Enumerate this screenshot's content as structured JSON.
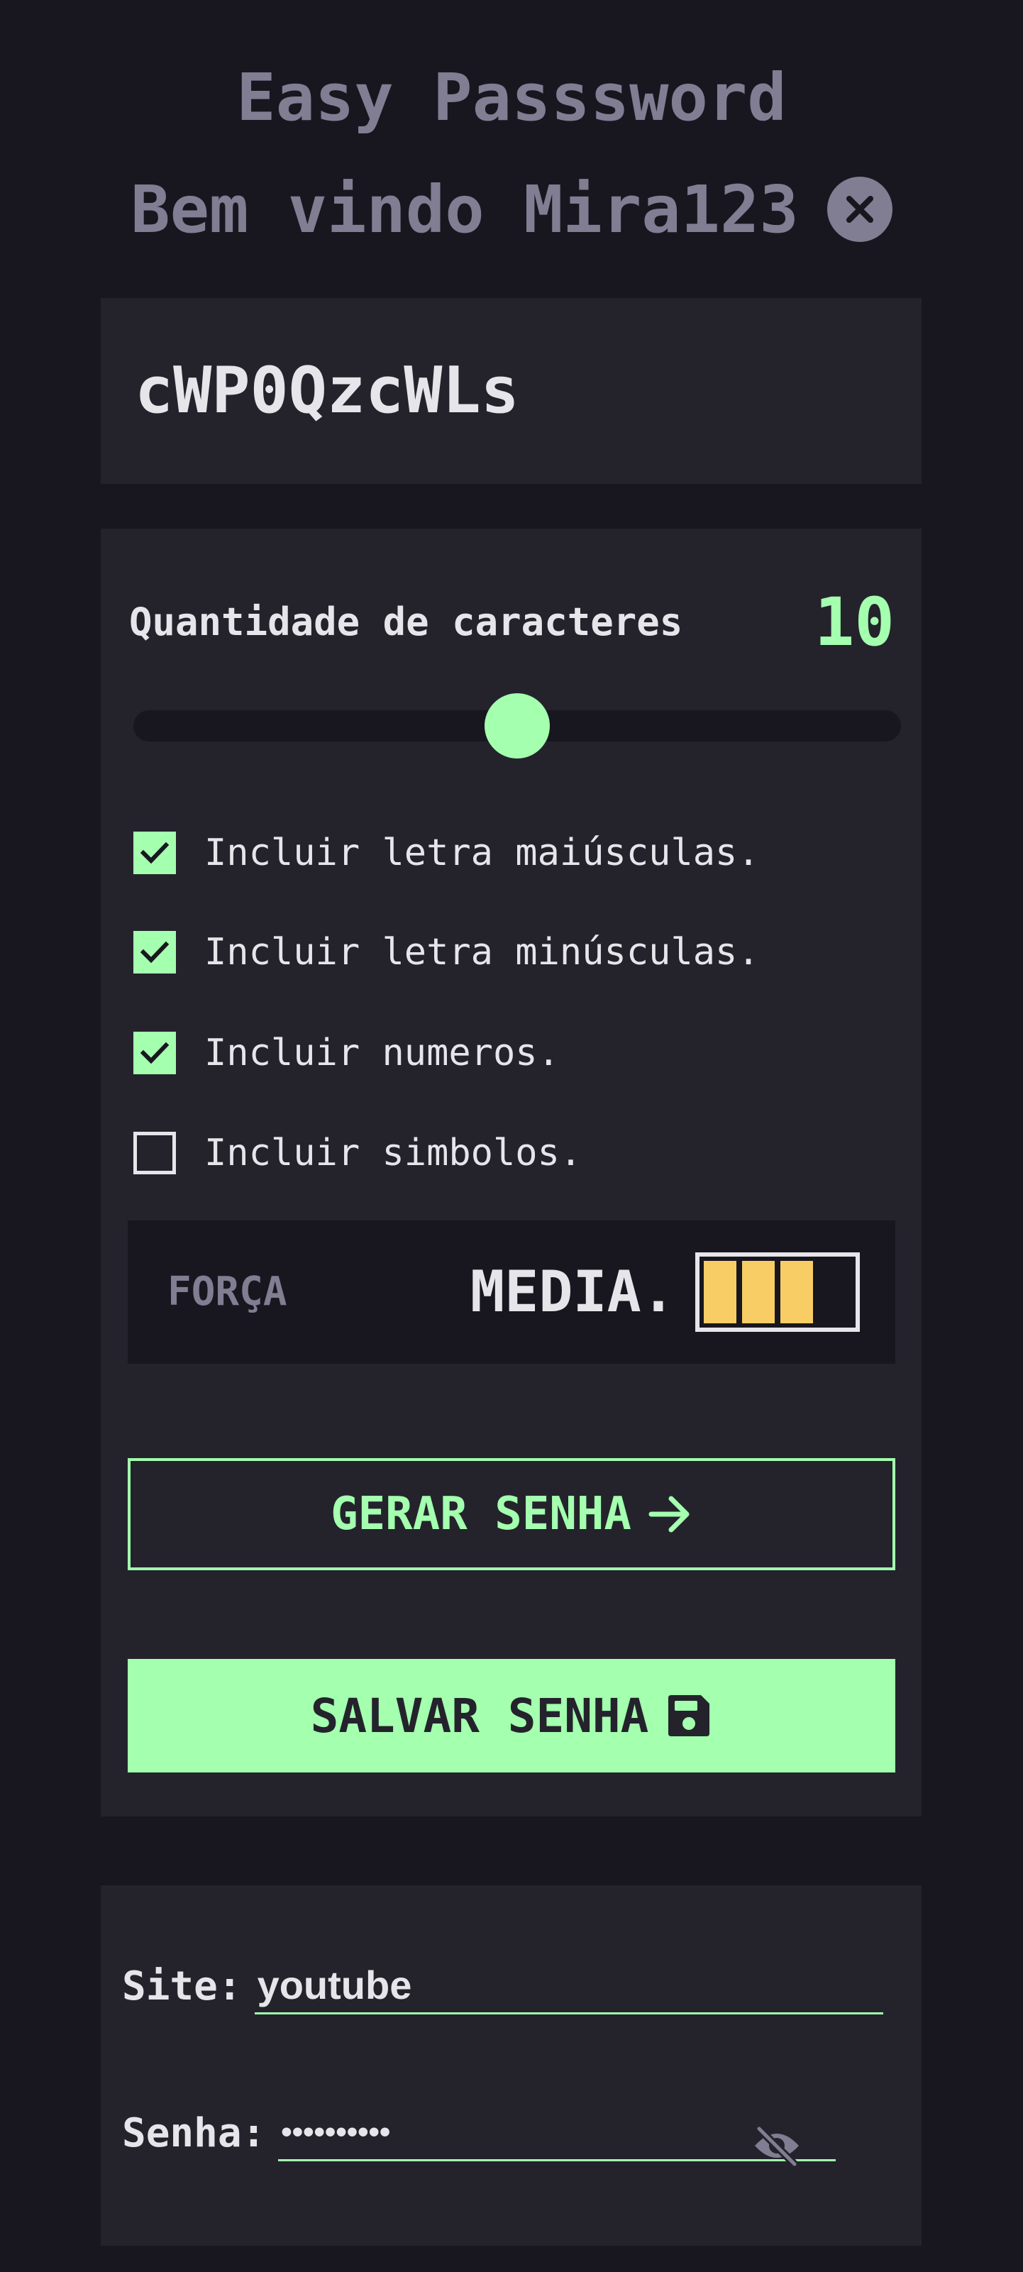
{
  "header": {
    "app_title": "Easy Passsword",
    "welcome": "Bem vindo Mira123"
  },
  "generator": {
    "password": "cWP0QzcWLs",
    "length_label": "Quantidade de caracteres",
    "length_value": "10",
    "length_slider_fraction": 0.5,
    "options": [
      {
        "label": "Incluir letra maiúsculas.",
        "checked": true
      },
      {
        "label": "Incluir letra minúsculas.",
        "checked": true
      },
      {
        "label": "Incluir numeros.",
        "checked": true
      },
      {
        "label": "Incluir simbolos.",
        "checked": false
      }
    ],
    "strength": {
      "label": "FORÇA",
      "value": "MEDIA.",
      "level": 3,
      "max_level": 4,
      "color": "#f8cd65"
    },
    "generate_button_label": "GERAR SENHA",
    "save_button_label": "SALVAR SENHA"
  },
  "save_form": {
    "site_label": "Site:",
    "site_value": "youtube",
    "password_label": "Senha:",
    "password_value": "••••••••••"
  },
  "colors": {
    "background": "#18171f",
    "card": "#24232c",
    "accent": "#a4ffaf",
    "muted": "#817d92",
    "text": "#e6e5ea",
    "strength_medium": "#f8cd65"
  },
  "icons": {
    "logout": "close-circle-icon",
    "generate": "arrow-right-icon",
    "save": "floppy-disk-icon",
    "visibility": "eye-slash-icon",
    "checkbox": "check-icon"
  }
}
